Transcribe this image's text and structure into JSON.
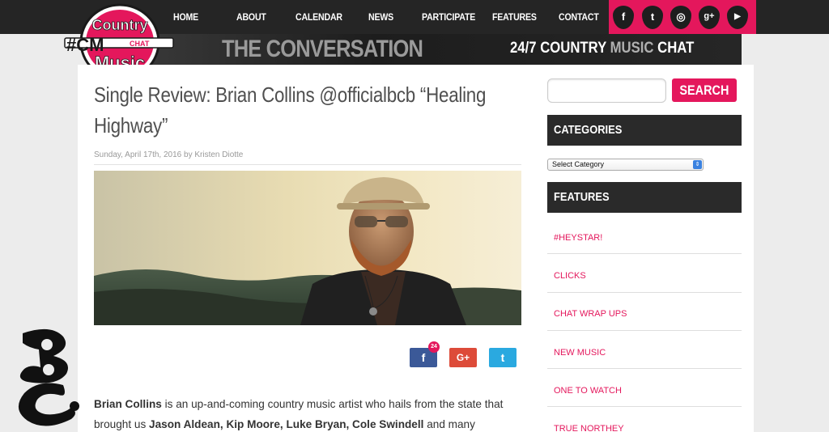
{
  "nav": {
    "items": [
      "HOME",
      "ABOUT",
      "CALENDAR",
      "NEWS",
      "PARTICIPATE",
      "FEATURES",
      "CONTACT"
    ]
  },
  "social": {
    "icons": [
      "facebook-icon",
      "twitter-icon",
      "instagram-icon",
      "google-plus-icon",
      "youtube-icon"
    ],
    "glyphs": [
      "f",
      "t",
      "◎",
      "g+",
      "▶"
    ]
  },
  "logo": {
    "line1": "Country",
    "line2": "Music",
    "hashtag": "#CM",
    "chat": "CHAT"
  },
  "banner": {
    "left": "THE CONVERSATION",
    "tag_1": "24/7",
    "tag_2": "COUNTRY",
    "tag_3": "MUSIC",
    "tag_4": "CHAT"
  },
  "article": {
    "title": "Single Review: Brian Collins @officialbcb “Healing Highway”",
    "meta": "Sunday, April 17th, 2016 by Kristen Diotte",
    "share_count": "24",
    "share_fb": "f",
    "share_gp": "G+",
    "share_tw": "t",
    "body_1": "Brian Collins",
    "body_2": " is an up-and-coming country music artist who hails from the state that brought us ",
    "body_3": "Jason Aldean, Kip Moore, Luke Bryan, Cole Swindell",
    "body_4": " and many"
  },
  "sidebar": {
    "search_placeholder": "",
    "search_button": "SEARCH",
    "categories_head": "CATEGORIES",
    "select_value": "Select Category",
    "features_head": "FEATURES",
    "features": [
      "#HEYSTAR!",
      "CLICKS",
      "CHAT WRAP UPS",
      "NEW MUSIC",
      "ONE TO WATCH",
      "TRUE NORTHEY"
    ]
  },
  "colors": {
    "accent": "#e4175c",
    "nav_bg": "#252525"
  }
}
